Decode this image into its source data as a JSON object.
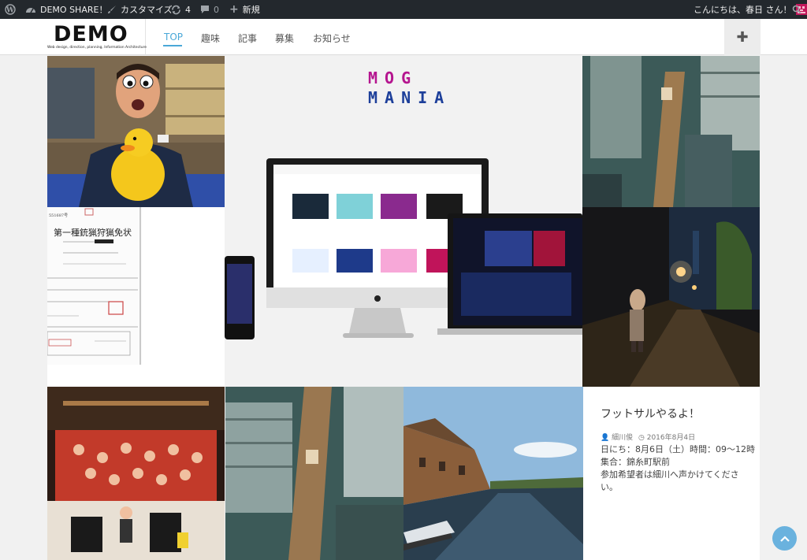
{
  "adminbar": {
    "site_name": "DEMO SHARE！",
    "customize": "カスタマイズ",
    "updates": "4",
    "comments": "0",
    "new": "新規",
    "greeting": "こんにちは、春日 さん！"
  },
  "header": {
    "logo": "DEMO",
    "tagline": "Web design, direction, planning, Information Architecture"
  },
  "nav": {
    "items": [
      "TOP",
      "趣味",
      "記事",
      "募集",
      "お知らせ"
    ],
    "active": "TOP"
  },
  "hero": {
    "brand_top": "MOG",
    "brand_bottom": "MANIA"
  },
  "certificate": {
    "title": "第一種銃猟狩猟免状"
  },
  "post": {
    "title": "フットサルやるよ！",
    "author": "細川俊",
    "date": "2016年8月4日",
    "body_line1": "日にち：8月6日（土）時間：09～12時",
    "body_line2": "集合：錦糸町駅前",
    "body_line3": "参加希望者は細川へ声かけてください。"
  },
  "colors": {
    "adminbar": "#23282d",
    "accent": "#4aa8d8",
    "scroll_button": "#6ab2de"
  }
}
